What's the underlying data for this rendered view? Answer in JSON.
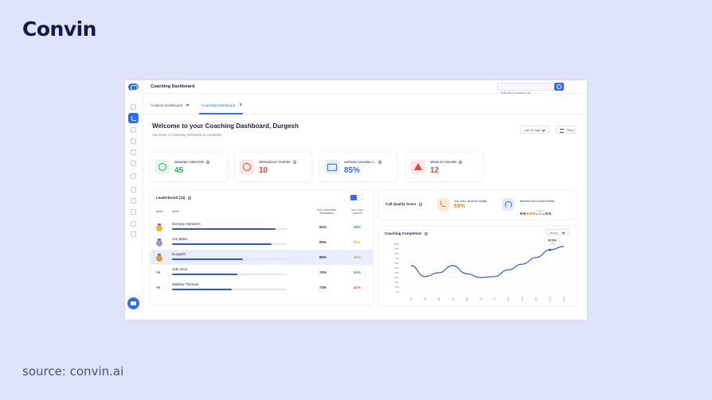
{
  "brand": "Convin",
  "source": "source: convin.ai",
  "app": {
    "title": "Coaching Dashboard",
    "search_placeholder": "Enter text to search call",
    "tabs": [
      {
        "label": "Analysis Dashboard",
        "active": false
      },
      {
        "label": "Coaching Dashboard",
        "active": true
      }
    ],
    "welcome": "Welcome to your Coaching Dashboard, Durgesh",
    "subtitle": "You have 4 Coaching Sessions to complete.",
    "period": "Last 30 Days",
    "filters": "Filters"
  },
  "stats": [
    {
      "label": "SESSIONS COMPLETED",
      "value": "45",
      "color": "#2eaa55",
      "icon": "check-circle-icon"
    },
    {
      "label": "SESSIONS NOT STARTED",
      "value": "10",
      "color": "#e0433b",
      "icon": "blocked-icon"
    },
    {
      "label": "AVERAGE COACHING C...",
      "value": "85%",
      "color": "#2f6df6",
      "icon": "book-icon"
    },
    {
      "label": "AREAS OF CONCERN",
      "value": "12",
      "color": "#e0433b",
      "icon": "warning-icon"
    }
  ],
  "leaderboard": {
    "title": "Leaderboard (14)",
    "headers": {
      "rank": "RANK",
      "name": "NAME",
      "progress": "AVG. COACHING PROGRESS",
      "quality": "AVG. CALL QUALITY"
    },
    "rows": [
      {
        "rank": "",
        "medal": "gold",
        "name": "Everyon Sumbers",
        "bar": 0.9,
        "progress": "91%",
        "quality": "88%",
        "quality_color": "#2eaa55"
      },
      {
        "rank": "",
        "medal": "silver",
        "name": "Jon Bideri",
        "bar": 0.87,
        "progress": "90%",
        "quality": "61%",
        "quality_color": "#e8a62a"
      },
      {
        "rank": "",
        "medal": "bronze",
        "name": "Durgesh",
        "bar": 0.62,
        "progress": "85%",
        "quality": "69%",
        "quality_color": "#e8a62a",
        "highlight": true
      },
      {
        "rank": "#4",
        "medal": "",
        "name": "John Doe",
        "bar": 0.57,
        "progress": "74%",
        "quality": "84%",
        "quality_color": "#2eaa55"
      },
      {
        "rank": "#5",
        "medal": "",
        "name": "Mathew Thomas",
        "bar": 0.52,
        "progress": "73%",
        "quality": "41%",
        "quality_color": "#e0433b"
      }
    ]
  },
  "call_quality": {
    "title": "Call Quality Score",
    "avg_label": "AVG. CALL QUALITY SCORE",
    "avg_value": "69%",
    "recent_label": "RECENT CALLS EVALUATION",
    "recent_dots": [
      "#e0433b",
      "#e0433b",
      "#e8a62a",
      "#e8a62a",
      "#e8a62a",
      "#2eaa55",
      "#2eaa55",
      "#2eaa55",
      "#2eaa55",
      "#2eaa55"
    ],
    "tooltip": "48 Min"
  },
  "chart_data": {
    "type": "line",
    "title": "Coaching Completion",
    "granularity": "Monthly",
    "ylim": [
      0,
      100
    ],
    "yticks": [
      "100%",
      "90%",
      "80%",
      "70%",
      "60%",
      "50%",
      "40%",
      "30%",
      "20%",
      "10%",
      "0%"
    ],
    "x": [
      "Jan",
      "Feb",
      "Mar",
      "Apr",
      "May",
      "Jun",
      "Jul",
      "Aug",
      "Sep",
      "Oct",
      "Nov",
      "Dec"
    ],
    "series": [
      {
        "values": [
          55,
          32,
          40,
          55,
          38,
          30,
          32,
          46,
          58,
          72,
          88,
          95
        ]
      }
    ],
    "annotation": {
      "value": "95.75%",
      "label": "+7.5%"
    },
    "grid": true,
    "color": "#2f56d8"
  }
}
